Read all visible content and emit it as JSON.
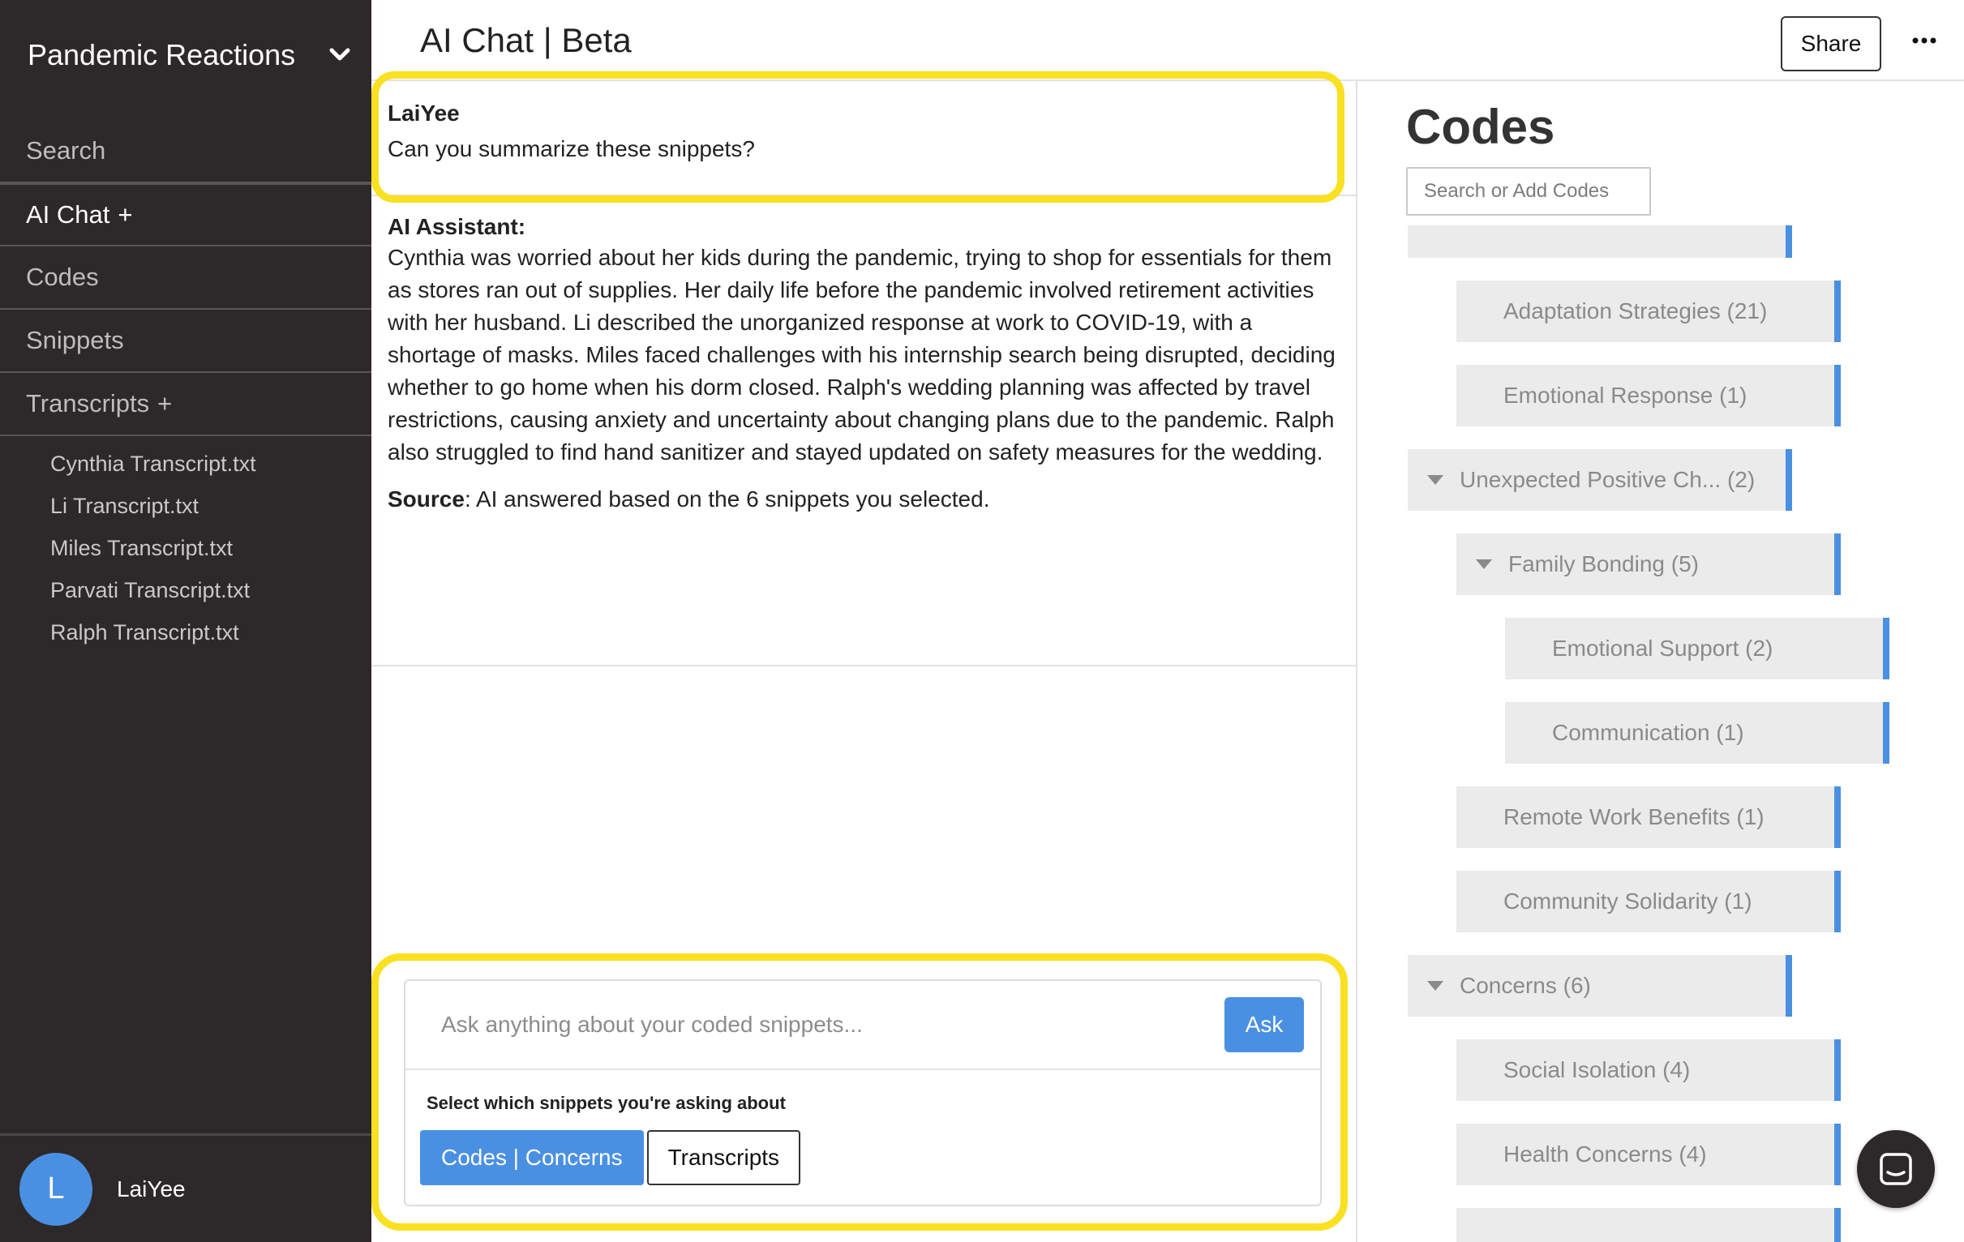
{
  "sidebar": {
    "project_name": "Pandemic Reactions",
    "nav": [
      {
        "label": "Search",
        "plus": ""
      },
      {
        "label": "AI Chat",
        "plus": "+"
      },
      {
        "label": "Codes",
        "plus": ""
      },
      {
        "label": "Snippets",
        "plus": ""
      },
      {
        "label": "Transcripts",
        "plus": "+"
      }
    ],
    "transcripts": [
      "Cynthia Transcript.txt",
      "Li Transcript.txt",
      "Miles Transcript.txt",
      "Parvati Transcript.txt",
      "Ralph Transcript.txt"
    ],
    "user": {
      "initial": "L",
      "name": "LaiYee"
    }
  },
  "topbar": {
    "title": "AI Chat | Beta",
    "share_label": "Share"
  },
  "chat": {
    "user_message": {
      "author": "LaiYee",
      "text": "Can you summarize these snippets?"
    },
    "ai_message": {
      "author": "AI Assistant:",
      "body": "Cynthia was worried about her kids during the pandemic, trying to shop for essentials for them as stores ran out of supplies. Her daily life before the pandemic involved retirement activities with her husband. Li described the unorganized response at work to COVID-19, with a shortage of masks. Miles faced challenges with his internship search being disrupted, deciding whether to go home when his dorm closed. Ralph's wedding planning was affected by travel restrictions, causing anxiety and uncertainty about changing plans due to the pandemic. Ralph also struggled to find hand sanitizer and stayed updated on safety measures for the wedding.",
      "source_label": "Source",
      "source_text": ": AI answered based on the 6 snippets you selected."
    },
    "ask": {
      "placeholder": "Ask anything about your coded snippets...",
      "button_label": "Ask",
      "select_label": "Select which snippets you're asking about",
      "options": [
        "Codes | Concerns",
        "Transcripts"
      ]
    }
  },
  "codes": {
    "title": "Codes",
    "search_placeholder": "Search or Add Codes",
    "items": [
      {
        "label": "Adaptation Strategies (21)"
      },
      {
        "label": "Emotional Response (1)"
      },
      {
        "label": "Unexpected Positive Ch... (2)"
      },
      {
        "label": "Family Bonding (5)"
      },
      {
        "label": "Emotional Support (2)"
      },
      {
        "label": "Communication (1)"
      },
      {
        "label": "Remote Work Benefits (1)"
      },
      {
        "label": "Community Solidarity (1)"
      },
      {
        "label": "Concerns (6)"
      },
      {
        "label": "Social Isolation (4)"
      },
      {
        "label": "Health Concerns (4)"
      }
    ]
  },
  "colors": {
    "sidebar_bg": "#2d2829",
    "accent_blue": "#4a90e2",
    "highlight_yellow": "#f9e021"
  }
}
